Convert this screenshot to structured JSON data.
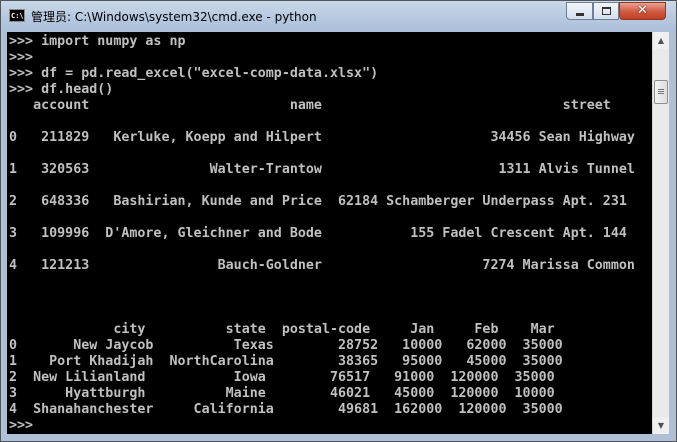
{
  "window": {
    "title": "管理员: C:\\Windows\\system32\\cmd.exe - python",
    "icon_text": "C:\\",
    "close_glyph": "✕"
  },
  "console": {
    "lines": [
      ">>> import numpy as np",
      ">>>",
      ">>> df = pd.read_excel(\"excel-comp-data.xlsx\")",
      ">>> df.head()",
      "   account                         name                              street",
      "",
      "0   211829   Kerluke, Koepp and Hilpert                     34456 Sean Highway",
      "",
      "1   320563               Walter-Trantow                      1311 Alvis Tunnel",
      "",
      "2   648336   Bashirian, Kunde and Price  62184 Schamberger Underpass Apt. 231",
      "",
      "3   109996  D'Amore, Gleichner and Bode           155 Fadel Crescent Apt. 144",
      "",
      "4   121213                Bauch-Goldner                    7274 Marissa Common",
      "",
      "",
      "",
      "             city          state  postal-code     Jan     Feb    Mar",
      "0       New Jaycob          Texas        28752   10000   62000  35000",
      "1    Port Khadijah  NorthCarolina        38365   95000   45000  35000",
      "2  New Lilianland           Iowa        76517   91000  120000  35000",
      "3      Hyattburgh          Maine        46021   45000  120000  10000",
      "4  Shanahanchester     California        49681  162000  120000  35000",
      ">>>"
    ]
  },
  "scrollbar": {
    "up_arrow": "▲",
    "down_arrow": "▼"
  }
}
